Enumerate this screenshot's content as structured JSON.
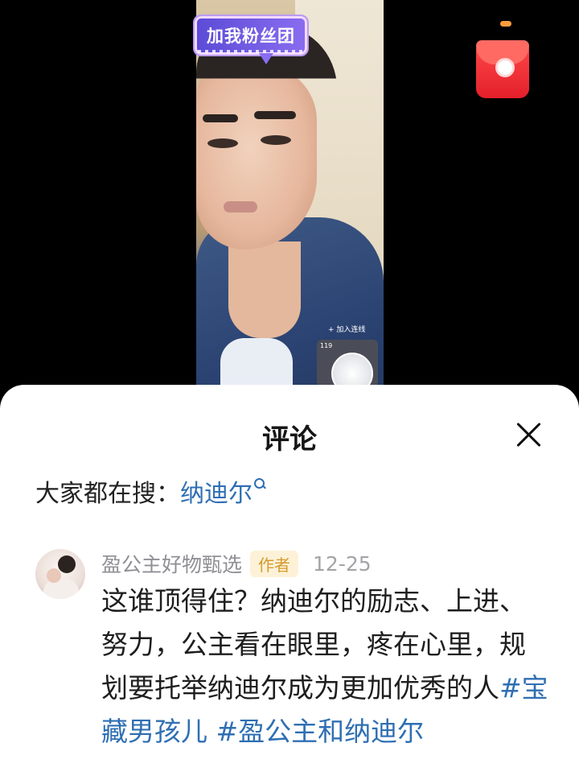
{
  "live": {
    "fan_badge": "加我粉丝团",
    "connect_label": "+ 加入连线",
    "pk_count": "119"
  },
  "comments_panel": {
    "title": "评论",
    "search_prefix": "大家都在搜：",
    "search_term": "纳迪尔",
    "comment": {
      "author": "盈公主好物甄选",
      "author_tag": "作者",
      "date": "12-25",
      "text": "这谁顶得住？纳迪尔的励志、上进、努力，公主看在眼里，疼在心里，规划要托举纳迪尔成为更加优秀的人",
      "hashtags": [
        "#宝藏男孩儿",
        "#盈公主和纳迪尔"
      ]
    }
  },
  "colors": {
    "link": "#2f6fb3",
    "tag_bg": "#fdf2d8",
    "tag_text": "#d59a2b",
    "red_envelope": "#e41f2a"
  }
}
